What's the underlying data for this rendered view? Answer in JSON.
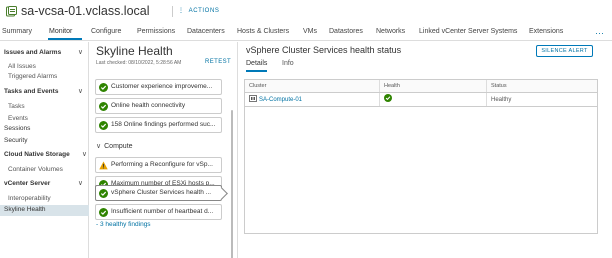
{
  "header": {
    "title": "sa-vcsa-01.vclass.local",
    "actions_label": "ACTIONS",
    "tabs": [
      {
        "label": "Summary"
      },
      {
        "label": "Monitor"
      },
      {
        "label": "Configure"
      },
      {
        "label": "Permissions"
      },
      {
        "label": "Datacenters"
      },
      {
        "label": "Hosts & Clusters"
      },
      {
        "label": "VMs"
      },
      {
        "label": "Datastores"
      },
      {
        "label": "Networks"
      },
      {
        "label": "Linked vCenter Server Systems"
      },
      {
        "label": "Extensions"
      }
    ],
    "more_label": "···",
    "active_tab": "Monitor"
  },
  "nav": {
    "items": [
      {
        "label": "Issues and Alarms",
        "kind": "group"
      },
      {
        "label": "All Issues",
        "kind": "child"
      },
      {
        "label": "Triggered Alarms",
        "kind": "child"
      },
      {
        "label": "Tasks and Events",
        "kind": "group"
      },
      {
        "label": "Tasks",
        "kind": "child"
      },
      {
        "label": "Events",
        "kind": "child"
      },
      {
        "label": "Sessions",
        "kind": "top"
      },
      {
        "label": "Security",
        "kind": "top"
      },
      {
        "label": "Cloud Native Storage",
        "kind": "group"
      },
      {
        "label": "Container Volumes",
        "kind": "child"
      },
      {
        "label": "vCenter Server",
        "kind": "group"
      },
      {
        "label": "Interoperability",
        "kind": "child"
      },
      {
        "label": "Skyline Health",
        "kind": "top",
        "selected": true
      }
    ]
  },
  "skyline": {
    "title": "Skyline Health",
    "last_checked": "Last checked: 08/10/2022, 5:28:56 AM",
    "retest_label": "RETEST",
    "findings_top": [
      {
        "text": "Customer experience improveme...",
        "status": "ok"
      },
      {
        "text": "Online health connectivity",
        "status": "ok"
      },
      {
        "text": "158 Online findings performed suc...",
        "status": "ok"
      }
    ],
    "compute_label": "Compute",
    "findings_compute": [
      {
        "text": "Performing a Reconfigure for vSp...",
        "status": "warning"
      },
      {
        "text": "Maximum number of ESXi hosts p...",
        "status": "ok"
      },
      {
        "text": "vSphere Cluster Services health ...",
        "status": "ok",
        "selected": true
      },
      {
        "text": "Insufficient number of heartbeat d...",
        "status": "ok"
      }
    ],
    "healthy_findings_label": "- 3 healthy findings"
  },
  "detail": {
    "title": "vSphere Cluster Services health status",
    "silence_label": "SILENCE ALERT",
    "subtabs": [
      {
        "label": "Details"
      },
      {
        "label": "Info"
      }
    ],
    "columns": [
      "Cluster",
      "Health",
      "Status"
    ],
    "rows": [
      {
        "cluster": "SA-Compute-01",
        "health": "ok",
        "status": "Healthy"
      }
    ]
  },
  "colors": {
    "accent": "#0079b8",
    "link": "#0072a3",
    "ok": "#2f8400",
    "warning": "#e6a100",
    "nav_selected": "#d8e3e9"
  }
}
